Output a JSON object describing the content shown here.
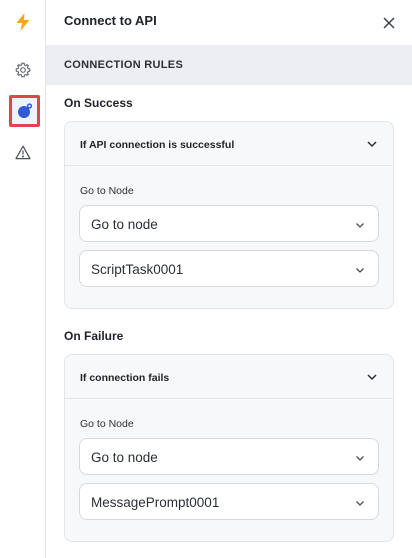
{
  "header": {
    "title": "Connect to API"
  },
  "section": {
    "title": "CONNECTION RULES"
  },
  "rail": {
    "icons": [
      "lightning-icon",
      "gear-icon",
      "api-node-icon",
      "warning-icon"
    ],
    "accent": "#f5a623",
    "selected_color": "#2f5bd3",
    "highlight": "#e0454b"
  },
  "success": {
    "heading": "On Success",
    "card_title": "If API connection is successful",
    "field_label": "Go to Node",
    "select_1": "Go to node",
    "select_2": "ScriptTask0001"
  },
  "failure": {
    "heading": "On Failure",
    "card_title": "If connection fails",
    "field_label": "Go to Node",
    "select_1": "Go to node",
    "select_2": "MessagePrompt0001"
  }
}
